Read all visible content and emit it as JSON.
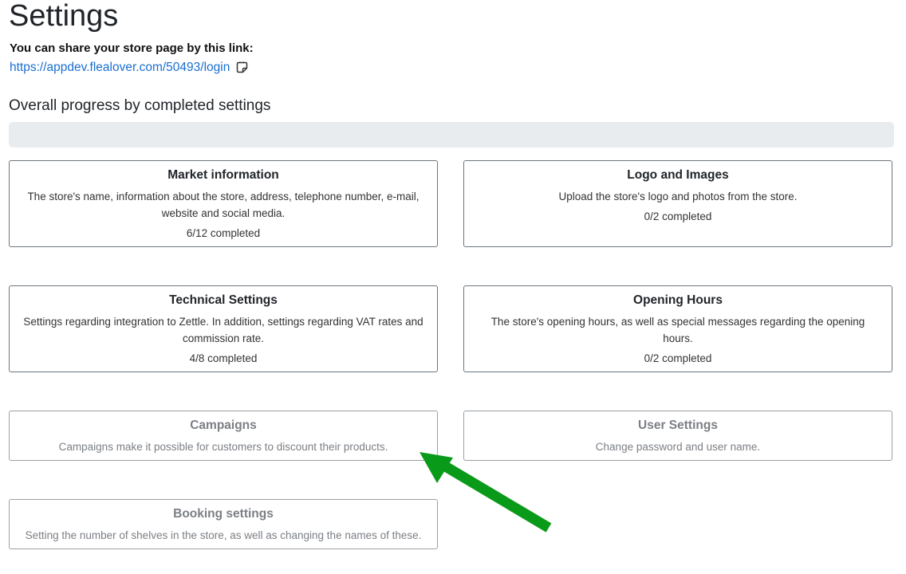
{
  "page": {
    "title": "Settings",
    "share_label": "You can share your store page by this link:",
    "share_link": "https://appdev.flealover.com/50493/login",
    "copy_icon": "copy-icon"
  },
  "progress": {
    "title": "Overall progress by completed settings",
    "fraction": 0
  },
  "cards": [
    {
      "title": "Market information",
      "description": "The store's name, information about the store, address, telephone number, e-mail, website and social media.",
      "progress": "6/12 completed"
    },
    {
      "title": "Logo and Images",
      "description": "Upload the store's logo and photos from the store.",
      "progress": "0/2 completed"
    },
    {
      "title": "Technical Settings",
      "description": "Settings regarding integration to Zettle. In addition, settings regarding VAT rates and commission rate.",
      "progress": "4/8 completed"
    },
    {
      "title": "Opening Hours",
      "description": "The store's opening hours, as well as special messages regarding the opening hours.",
      "progress": "0/2 completed"
    },
    {
      "title": "Campaigns",
      "description": "Campaigns make it possible for customers to discount their products."
    },
    {
      "title": "User Settings",
      "description": "Change password and user name."
    },
    {
      "title": "Booking settings",
      "description": "Setting the number of shelves in the store, as well as changing the names of these."
    }
  ],
  "colors": {
    "link": "#1a6fd1",
    "arrow": "#0a9a1a",
    "progress_track": "#e9ecef"
  },
  "annotation": {
    "icon": "arrow-icon"
  }
}
